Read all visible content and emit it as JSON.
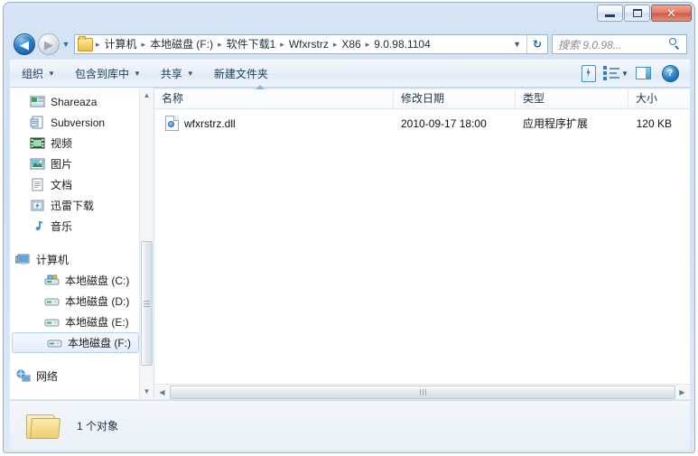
{
  "window": {
    "title": "",
    "controls": {
      "minimize": "minimize-button",
      "maximize": "maximize-button",
      "close_glyph": "✕"
    }
  },
  "navigation": {
    "back_glyph": "◀",
    "forward_glyph": "▶",
    "dropdown_glyph": "▼",
    "refresh_glyph": "↻"
  },
  "address": {
    "folder_icon": "folder-icon",
    "breadcrumbs": [
      "计算机",
      "本地磁盘 (F:)",
      "软件下载1",
      "Wfxrstrz",
      "X86",
      "9.0.98.1104"
    ],
    "separator": "▸",
    "caret": "▼"
  },
  "search": {
    "placeholder": "搜索 9.0.98...",
    "icon": "magnifier-icon"
  },
  "toolbar": {
    "items": [
      {
        "label": "组织",
        "caret": "▼"
      },
      {
        "label": "包含到库中",
        "caret": "▼"
      },
      {
        "label": "共享",
        "caret": "▼"
      },
      {
        "label": "新建文件夹",
        "caret": ""
      }
    ],
    "right_icons": [
      "burn-icon",
      "change-view-icon",
      "preview-pane-icon",
      "help-icon"
    ],
    "view_caret": "▼",
    "help_glyph": "?"
  },
  "sidebar": {
    "items": [
      {
        "label": "Shareaza",
        "level": 1,
        "icon": "shareaza-icon",
        "selected": false
      },
      {
        "label": "Subversion",
        "level": 1,
        "icon": "subversion-icon",
        "selected": false
      },
      {
        "label": "视频",
        "level": 1,
        "icon": "video-library-icon",
        "selected": false
      },
      {
        "label": "图片",
        "level": 1,
        "icon": "pictures-library-icon",
        "selected": false
      },
      {
        "label": "文档",
        "level": 1,
        "icon": "documents-library-icon",
        "selected": false
      },
      {
        "label": "迅雷下载",
        "level": 1,
        "icon": "thunder-download-icon",
        "selected": false
      },
      {
        "label": "音乐",
        "level": 1,
        "icon": "music-library-icon",
        "selected": false
      },
      {
        "label": "计算机",
        "level": 0,
        "icon": "computer-icon",
        "selected": false
      },
      {
        "label": "本地磁盘 (C:)",
        "level": 1,
        "icon": "system-drive-icon",
        "selected": false
      },
      {
        "label": "本地磁盘 (D:)",
        "level": 1,
        "icon": "drive-icon",
        "selected": false
      },
      {
        "label": "本地磁盘 (E:)",
        "level": 1,
        "icon": "drive-icon",
        "selected": false
      },
      {
        "label": "本地磁盘 (F:)",
        "level": 1,
        "icon": "drive-icon",
        "selected": true
      },
      {
        "label": "网络",
        "level": 0,
        "icon": "network-icon",
        "selected": false
      }
    ],
    "scroll_up_glyph": "▲",
    "scroll_down_glyph": "▼"
  },
  "filelist": {
    "columns": [
      "名称",
      "修改日期",
      "类型",
      "大小"
    ],
    "sort_column": "名称",
    "rows": [
      {
        "name": "wfxrstrz.dll",
        "date": "2010-09-17 18:00",
        "type": "应用程序扩展",
        "size": "120 KB",
        "icon": "dll-file-icon"
      }
    ],
    "hscroll_left_glyph": "◀",
    "hscroll_right_glyph": "▶"
  },
  "status": {
    "folder_icon": "open-folder-icon",
    "text": "1 个对象"
  }
}
